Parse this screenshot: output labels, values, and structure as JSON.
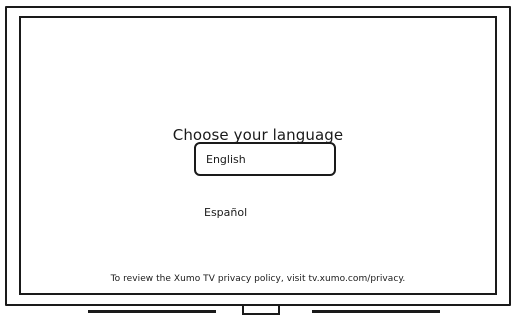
{
  "screen": {
    "title": "Choose your language",
    "options": [
      {
        "label": "English",
        "selected": true
      },
      {
        "label": "Español",
        "selected": false
      }
    ],
    "privacy_notice": "To review the Xumo TV privacy policy, visit tv.xumo.com/privacy."
  }
}
